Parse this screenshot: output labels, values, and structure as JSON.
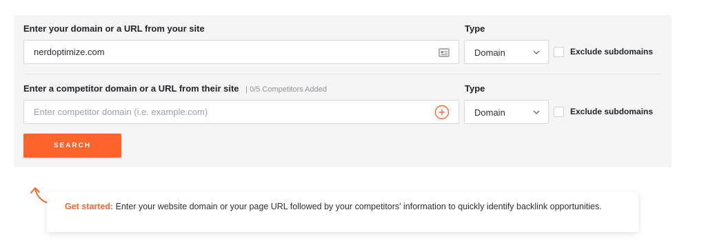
{
  "domain_section": {
    "label": "Enter your domain or a URL from your site",
    "value": "nerdoptimize.com",
    "type_label": "Type",
    "type_value": "Domain",
    "exclude_label": "Exclude subdomains",
    "input_icon": "address-card-icon"
  },
  "competitor_section": {
    "label": "Enter a competitor domain or a URL from their site",
    "counter": "| 0/5 Competitors Added",
    "placeholder": "Enter competitor domain (i.e. example.com)",
    "type_label": "Type",
    "type_value": "Domain",
    "exclude_label": "Exclude subdomains",
    "add_icon": "plus-circle-icon"
  },
  "search_button": {
    "label": "SEARCH"
  },
  "tip": {
    "highlight": "Get started:",
    "text": " Enter your website domain or your page URL followed by your competitors' information to quickly identify backlink opportunities."
  },
  "colors": {
    "accent": "#ff642d",
    "panel": "#f4f5f4"
  }
}
